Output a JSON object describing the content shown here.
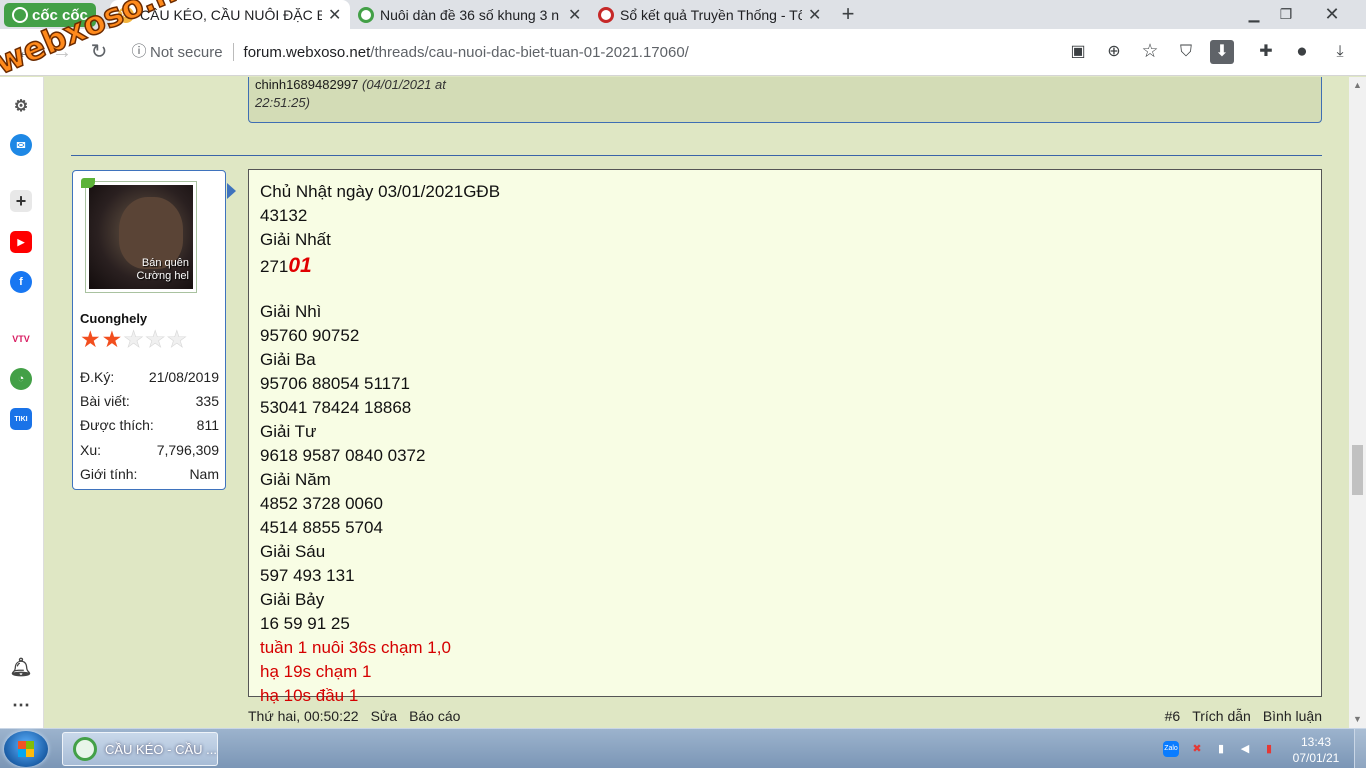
{
  "browser": {
    "brand": "cốc cốc",
    "tabs": [
      {
        "title": "CẦU KÉO, CẦU NUÔI ĐẶC BI",
        "favicon": "xs-favicon",
        "active": true
      },
      {
        "title": "Nuôi dàn đề 36 số khung 3 n",
        "favicon": "coccoc-favicon",
        "active": false
      },
      {
        "title": "Sổ kết quả Truyền Thống - Tổ",
        "favicon": "ketqua-favicon",
        "active": false
      }
    ],
    "new_tab": "+",
    "address": {
      "security": "Not secure",
      "host": "forum.webxoso.net",
      "path": "/threads/cau-nuoi-dac-biet-tuan-01-2021.17060/"
    }
  },
  "watermark": "webxoso.net",
  "previous_post": {
    "author": "chinh1689482997",
    "date": "(04/01/2021 at",
    "time": "22:51:25)"
  },
  "user": {
    "name": "Cuonghely",
    "avatar_caption": [
      "Bán quên",
      "Cường hel"
    ],
    "rating": 2,
    "rating_max": 5,
    "stats": [
      {
        "label": "Đ.Ký:",
        "value": "21/08/2019"
      },
      {
        "label": "Bài viết:",
        "value": "335"
      },
      {
        "label": "Được thích:",
        "value": "811"
      },
      {
        "label": "Xu:",
        "value": "7,796,309"
      },
      {
        "label": "Giới tính:",
        "value": "Nam"
      }
    ]
  },
  "post": {
    "title_line": "Chủ Nhật ngày 03/01/2021GĐB",
    "gdb": "43132",
    "giai_nhat_label": "Giải Nhất",
    "giai_nhat_prefix": "271",
    "giai_nhat_highlight": "01",
    "lines": [
      "Giải Nhì",
      "95760 90752",
      "Giải Ba",
      "95706 88054 51171",
      "53041 78424 18868",
      "Giải Tư",
      "9618 9587 0840 0372",
      "Giải Năm",
      "4852 3728 0060",
      "4514 8855 5704",
      "Giải Sáu",
      "597 493 131",
      "Giải Bảy",
      "16 59 91 25"
    ],
    "red_lines": [
      "tuần 1 nuôi 36s chạm 1,0",
      "hạ 19s chạm 1",
      "hạ 10s đầu 1"
    ]
  },
  "footer": {
    "timestamp": "Thứ hai, 00:50:22",
    "edit": "Sửa",
    "report": "Báo cáo",
    "post_number": "#6",
    "quote": "Trích dẫn",
    "comment": "Bình luận"
  },
  "taskbar": {
    "app_label": "CẦU KÉO - CẦU ...",
    "time": "13:43",
    "date": "07/01/21"
  },
  "colors": {
    "page_bg": "#dfe7c4",
    "post_bg": "#f8fde4",
    "accent_blue": "#3f73bd",
    "red_text": "#d50000",
    "brand_green": "#43a047"
  }
}
